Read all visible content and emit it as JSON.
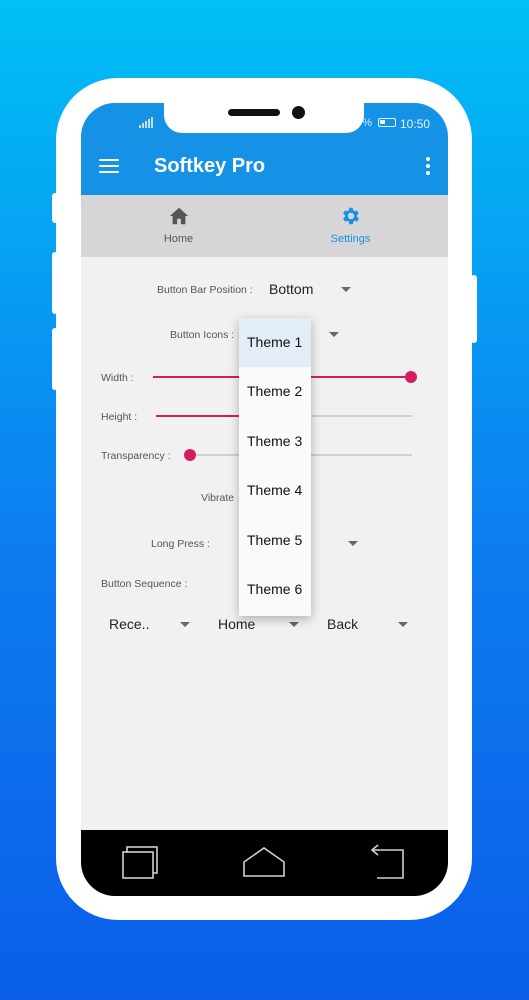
{
  "status": {
    "battery_pct": "%",
    "time": "10:50"
  },
  "app": {
    "title": "Softkey Pro"
  },
  "tabs": [
    {
      "label": "Home",
      "icon": "home-icon",
      "color": "#555555"
    },
    {
      "label": "Settings",
      "icon": "gear-icon",
      "color": "#1592e6"
    }
  ],
  "settings": {
    "bar_position": {
      "label": "Button Bar Position :",
      "value": "Bottom"
    },
    "button_icons": {
      "label": "Button Icons :"
    },
    "width": {
      "label": "Width :",
      "level": 1.0
    },
    "height": {
      "label": "Height :",
      "level": 0.35
    },
    "transparency": {
      "label": "Transparency :",
      "level": 0.0
    },
    "vibrate": {
      "label": "Vibrate"
    },
    "long_press": {
      "label": "Long Press :"
    },
    "sequence": {
      "label": "Button Sequence :",
      "items": [
        "Rece..",
        "Home",
        "Back"
      ]
    }
  },
  "dropdown": {
    "options": [
      "Theme 1",
      "Theme 2",
      "Theme 3",
      "Theme 4",
      "Theme 5",
      "Theme 6"
    ],
    "selected": "Theme 1"
  },
  "colors": {
    "primary": "#1592e6",
    "accent": "#d81b60",
    "background_top": "#00c0f5",
    "background_bottom": "#0a5ee8"
  }
}
